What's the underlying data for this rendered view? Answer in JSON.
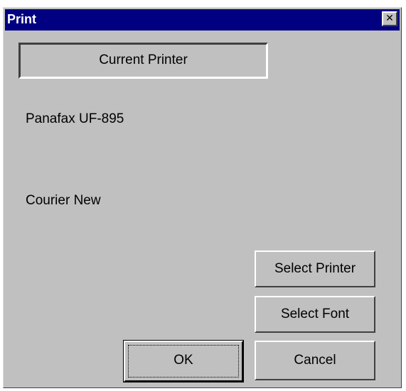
{
  "window": {
    "title": "Print",
    "close_glyph": "✕"
  },
  "group": {
    "label": "Current Printer"
  },
  "printer": {
    "name": "Panafax UF-895"
  },
  "font": {
    "name": "Courier New"
  },
  "buttons": {
    "select_printer": "Select Printer",
    "select_font": "Select Font",
    "ok": "OK",
    "cancel": "Cancel"
  },
  "icons": {
    "close": "close-icon"
  },
  "colors": {
    "titlebar": "#000080",
    "face": "#c0c0c0"
  }
}
